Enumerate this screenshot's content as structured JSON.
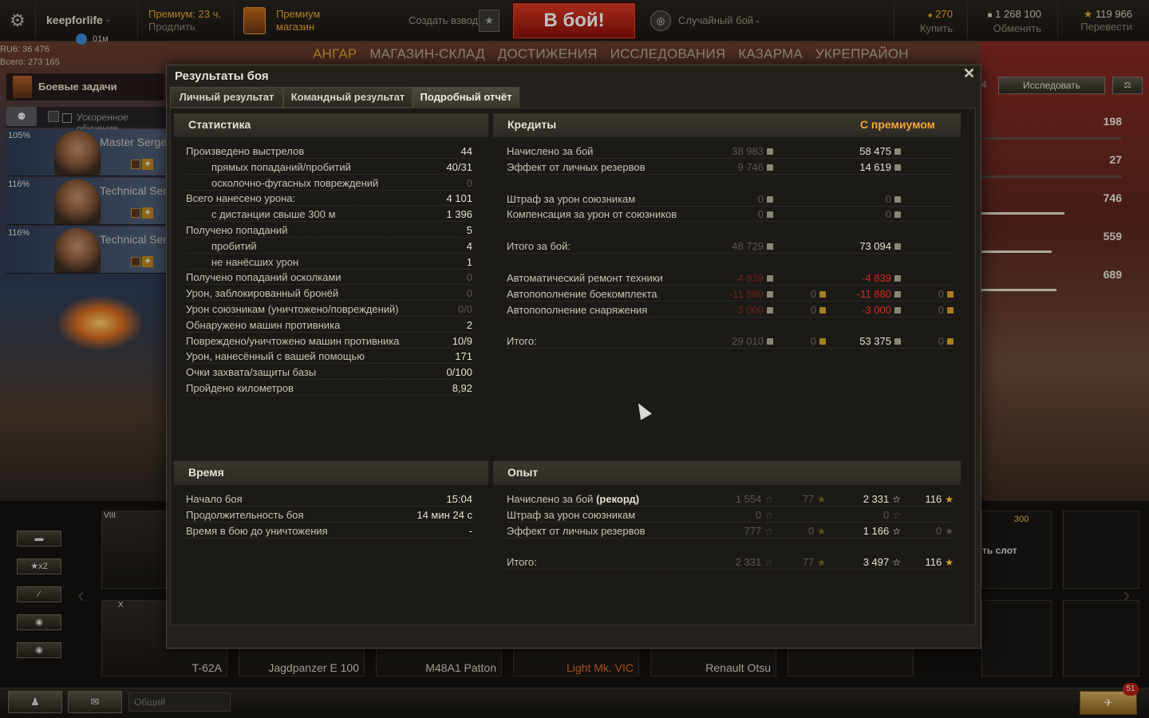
{
  "topbar": {
    "username": "keepforlife",
    "timer": "01м",
    "premium_title": "Премиум: 23 ч.",
    "premium_action": "Продлить",
    "shop_line1": "Премиум",
    "shop_line2": "магазин",
    "platoon": "Создать взвод",
    "fight": "В бой!",
    "battle_mode": "Случайный бой",
    "gold": "270",
    "gold_action": "Купить",
    "free_xp": "1 268 100",
    "free_xp_action": "Обменять",
    "credits": "119 966",
    "credits_action": "Перевести"
  },
  "nav": [
    "АНГАР",
    "МАГАЗИН-СКЛАД",
    "ДОСТИЖЕНИЯ",
    "ИССЛЕДОВАНИЯ",
    "КАЗАРМА",
    "УКРЕПРАЙОН"
  ],
  "account": {
    "line1": "RU6: 36 476",
    "line2": "Всего: 273 165"
  },
  "left": {
    "quests": "Боевые задачи",
    "training": "Ускоренное обучение",
    "crew": [
      {
        "pct": "105%",
        "name": "Master Sergeant"
      },
      {
        "pct": "116%",
        "name": "Technical Sergeant"
      },
      {
        "pct": "116%",
        "name": "Technical Sergeant"
      }
    ]
  },
  "right": {
    "research": "Исследовать",
    "research_count_suffix": "4",
    "stats": [
      "198",
      "27",
      "746",
      "559",
      "689"
    ]
  },
  "carousel": {
    "tier_viii": "VIII",
    "tier_x": "X",
    "tanks": [
      "T-62A",
      "Jagdpanzer E 100",
      "M48A1 Patton",
      "Light Mk. VIC",
      "Renault Otsu"
    ],
    "slot_price": "300",
    "slot_label": "ть слот",
    "side_x2": "x2"
  },
  "bottombar": {
    "chat_placeholder": "Общий",
    "notif_count": "51"
  },
  "modal": {
    "title": "Результаты боя",
    "tabs": [
      "Личный результат",
      "Командный результат",
      "Подробный отчёт"
    ],
    "stats": {
      "header": "Статистика",
      "rows": [
        {
          "label": "Произведено выстрелов",
          "value": "44",
          "indent": false,
          "dim": false
        },
        {
          "label": "прямых попаданий/пробитий",
          "value": "40/31",
          "indent": true,
          "dim": false
        },
        {
          "label": "осколочно-фугасных повреждений",
          "value": "0",
          "indent": true,
          "dim": true
        },
        {
          "label": "Всего нанесено урона:",
          "value": "4 101",
          "indent": false,
          "dim": false
        },
        {
          "label": "с дистанции свыше 300 м",
          "value": "1 396",
          "indent": true,
          "dim": false
        },
        {
          "label": "Получено попаданий",
          "value": "5",
          "indent": false,
          "dim": false
        },
        {
          "label": "пробитий",
          "value": "4",
          "indent": true,
          "dim": false
        },
        {
          "label": "не нанёсших урон",
          "value": "1",
          "indent": true,
          "dim": false
        },
        {
          "label": "Получено попаданий осколками",
          "value": "0",
          "indent": false,
          "dim": true
        },
        {
          "label": "Урон, заблокированный бронёй",
          "value": "0",
          "indent": false,
          "dim": true
        },
        {
          "label": "Урон союзникам (уничтожено/повреждений)",
          "value": "0/0",
          "indent": false,
          "dim": true
        },
        {
          "label": "Обнаружено машин противника",
          "value": "2",
          "indent": false,
          "dim": false
        },
        {
          "label": "Повреждено/уничтожено машин противника",
          "value": "10/9",
          "indent": false,
          "dim": false
        },
        {
          "label": "Урон, нанесённый с вашей помощью",
          "value": "171",
          "indent": false,
          "dim": false
        },
        {
          "label": "Очки захвата/защиты базы",
          "value": "0/100",
          "indent": false,
          "dim": false
        },
        {
          "label": "Пройдено километров",
          "value": "8,92",
          "indent": false,
          "dim": false
        }
      ]
    },
    "credits": {
      "header": "Кредиты",
      "premium_header": "С премиумом",
      "rows": [
        {
          "label": "Начислено за бой",
          "base": "38 983",
          "base_gold": "",
          "prem": "58 475",
          "prem_gold": "",
          "red": false
        },
        {
          "label": "Эффект от личных резервов",
          "base": "9 746",
          "base_gold": "",
          "prem": "14 619",
          "prem_gold": "",
          "red": false
        },
        {
          "label": "Штраф за урон союзникам",
          "base": "0",
          "base_gold": "",
          "prem": "0",
          "prem_gold": "",
          "red": false,
          "gap": true
        },
        {
          "label": "Компенсация за урон от союзников",
          "base": "0",
          "base_gold": "",
          "prem": "0",
          "prem_gold": "",
          "red": false
        },
        {
          "label": "Итого за бой:",
          "base": "48 729",
          "base_gold": "",
          "prem": "73 094",
          "prem_gold": "",
          "red": false,
          "gap": true
        },
        {
          "label": "Автоматический ремонт техники",
          "base": "-4 839",
          "base_gold": "",
          "prem": "-4 839",
          "prem_gold": "",
          "red": true,
          "gap": true
        },
        {
          "label": "Автопополнение боекомплекта",
          "base": "-11 880",
          "base_gold": "0",
          "prem": "-11 880",
          "prem_gold": "0",
          "red": true
        },
        {
          "label": "Автопополнение снаряжения",
          "base": "-3 000",
          "base_gold": "0",
          "prem": "-3 000",
          "prem_gold": "0",
          "red": true
        },
        {
          "label": "Итого:",
          "base": "29 010",
          "base_gold": "0",
          "prem": "53 375",
          "prem_gold": "0",
          "red": false,
          "gap": true
        }
      ]
    },
    "time": {
      "header": "Время",
      "rows": [
        {
          "label": "Начало боя",
          "value": "15:04"
        },
        {
          "label": "Продолжительность боя",
          "value": "14 мин 24 с"
        },
        {
          "label": "Время в бою до уничтожения",
          "value": "-"
        }
      ]
    },
    "xp": {
      "header": "Опыт",
      "rows": [
        {
          "label": "Начислено за бой",
          "label_bold": "(рекорд)",
          "base": "1 554",
          "base_free": "77",
          "prem": "2 331",
          "prem_free": "116",
          "gap": false
        },
        {
          "label": "Штраф за урон союзникам",
          "label_bold": "",
          "base": "0",
          "base_free": "",
          "prem": "0",
          "prem_free": "",
          "gap": false
        },
        {
          "label": "Эффект от личных резервов",
          "label_bold": "",
          "base": "777",
          "base_free": "0",
          "prem": "1 166",
          "prem_free": "0",
          "gap": false
        },
        {
          "label": "Итого:",
          "label_bold": "",
          "base": "2 331",
          "base_free": "77",
          "prem": "3 497",
          "prem_free": "116",
          "gap": true
        }
      ]
    }
  }
}
